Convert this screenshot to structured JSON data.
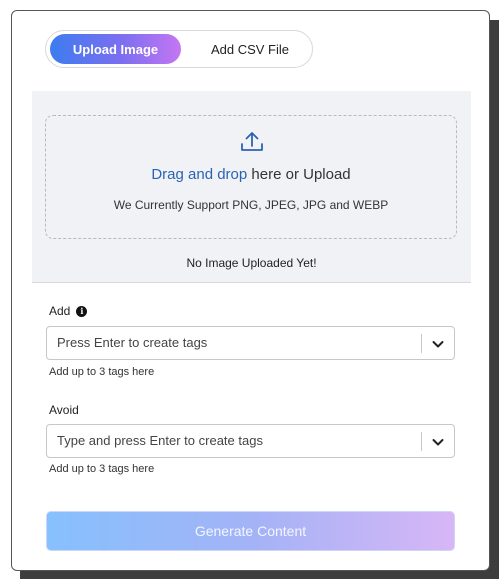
{
  "tabs": {
    "upload_image": "Upload Image",
    "add_csv_file": "Add CSV File"
  },
  "upload": {
    "drag_link_text": "Drag and drop",
    "drag_rest_text": " here or Upload",
    "supported_formats": "We Currently Support PNG, JPEG, JPG and WEBP",
    "status": "No Image Uploaded Yet!"
  },
  "add_field": {
    "label": "Add",
    "placeholder": "Press Enter to create tags",
    "helper": "Add up to 3 tags here"
  },
  "avoid_field": {
    "label": "Avoid",
    "placeholder": "Type and press Enter to create tags",
    "helper": "Add up to 3 tags here"
  },
  "generate_button": {
    "label": "Generate Content"
  },
  "colors": {
    "accent_start": "#3d7cf0",
    "accent_end": "#c476f3",
    "link": "#2b63b3",
    "upload_bg": "#f1f2f6"
  },
  "icons": {
    "upload": "upload-icon",
    "info": "info-icon",
    "chevron": "chevron-down-icon"
  }
}
